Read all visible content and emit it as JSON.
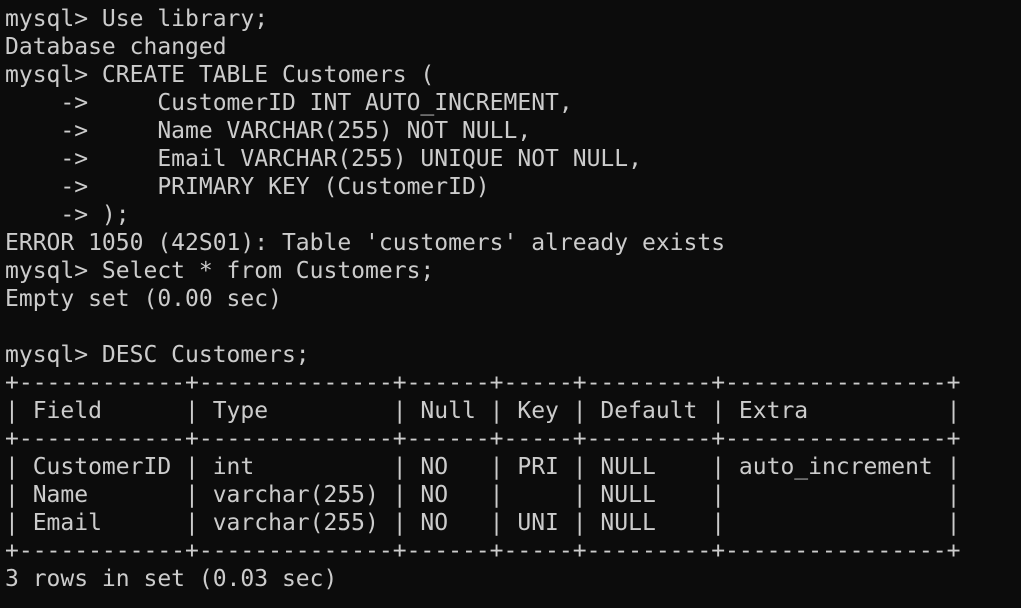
{
  "terminal": {
    "lines": [
      "mysql> Use library;",
      "Database changed",
      "mysql> CREATE TABLE Customers (",
      "    ->     CustomerID INT AUTO_INCREMENT,",
      "    ->     Name VARCHAR(255) NOT NULL,",
      "    ->     Email VARCHAR(255) UNIQUE NOT NULL,",
      "    ->     PRIMARY KEY (CustomerID)",
      "    -> );",
      "ERROR 1050 (42S01): Table 'customers' already exists",
      "mysql> Select * from Customers;",
      "Empty set (0.00 sec)",
      "",
      "mysql> DESC Customers;",
      "+------------+--------------+------+-----+---------+----------------+",
      "| Field      | Type         | Null | Key | Default | Extra          |",
      "+------------+--------------+------+-----+---------+----------------+",
      "| CustomerID | int          | NO   | PRI | NULL    | auto_increment |",
      "| Name       | varchar(255) | NO   |     | NULL    |                |",
      "| Email      | varchar(255) | NO   | UNI | NULL    |                |",
      "+------------+--------------+------+-----+---------+----------------+",
      "3 rows in set (0.03 sec)"
    ]
  },
  "colors": {
    "background": "#0c0c0c",
    "text": "#cccccc"
  }
}
